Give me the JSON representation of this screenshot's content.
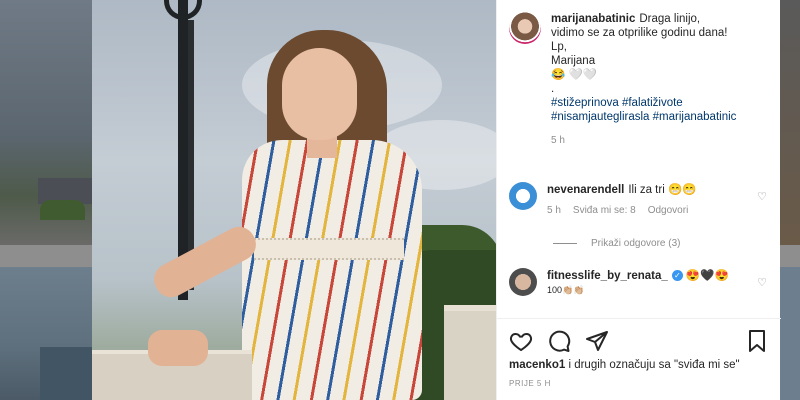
{
  "post": {
    "username": "marijanabatinic",
    "caption_lines": [
      "Draga linijo,",
      "vidimo se za otprilike godinu dana!",
      "Lp,",
      "Marijana",
      "😂 🤍🤍",
      "."
    ],
    "hashtags_line1": [
      "#stižeprinova",
      "#falatiživote"
    ],
    "hashtags_line2": [
      "#nisamjauteglirasla",
      "#marijanabatinic"
    ],
    "time": "5 h"
  },
  "comments": [
    {
      "username": "nevenarendell",
      "text": "Ili za tri 😁😁",
      "time": "5 h",
      "likes": "Sviđa mi se: 8",
      "reply": "Odgovori"
    },
    {
      "username": "fitnesslife_by_renata_",
      "text": "😍🖤😍",
      "text2": "100👏🏼👏🏼"
    }
  ],
  "view_replies": "Prikaži odgovore (3)",
  "likes": {
    "user": "macenko1",
    "rest": " i drugih označuju sa \"sviđa mi se\""
  },
  "posted_ago": "PRIJE 5 H",
  "icons": {
    "like": "heart-icon",
    "comment": "comment-icon",
    "share": "share-icon",
    "save": "bookmark-icon"
  }
}
